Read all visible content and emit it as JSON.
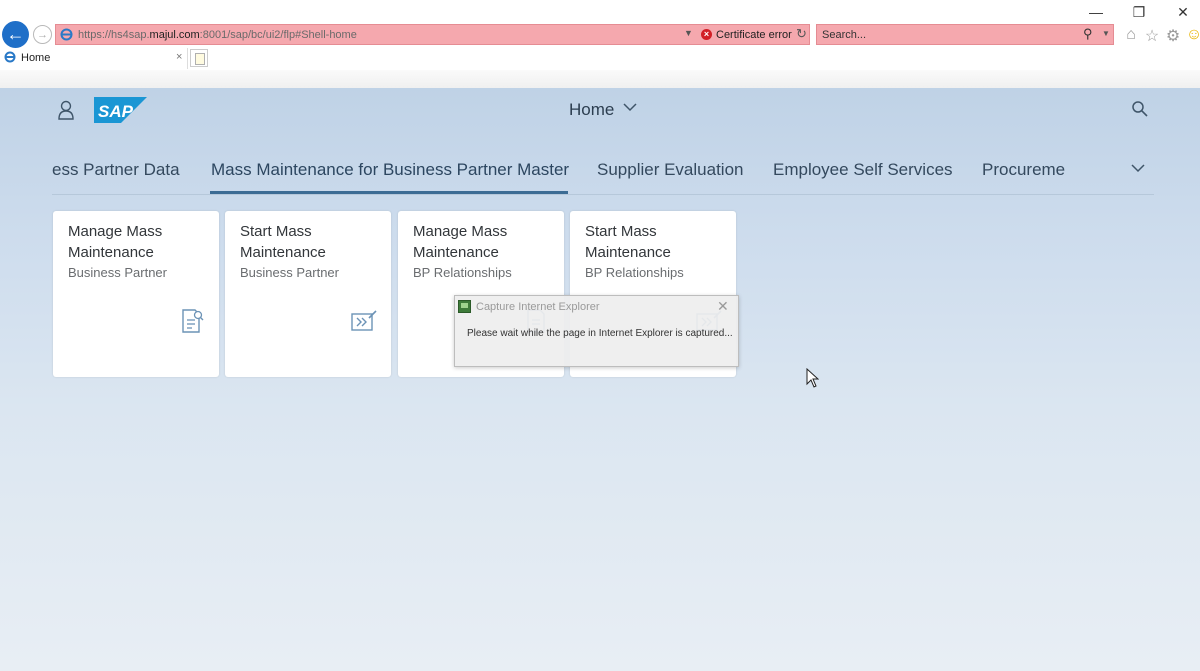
{
  "browser": {
    "window_controls": {
      "minimize": "—",
      "restore": "❐",
      "close": "✕"
    },
    "address": {
      "url_prefix": "https://hs4sap.",
      "url_domain": "majul.com",
      "url_suffix": ":8001/sap/bc/ui2/flp#Shell-home",
      "certificate_error": "Certificate error"
    },
    "search": {
      "placeholder": "Search..."
    },
    "tab": {
      "title": "Home",
      "close": "×"
    },
    "toolbar_icons": [
      "home-icon",
      "favorites-star-icon",
      "settings-gear-icon",
      "smiley-feedback-icon"
    ],
    "colors": {
      "address_bg": "#f5a8ae",
      "back_button": "#1f6fc8",
      "cert_error_icon": "#d21f26"
    }
  },
  "shell": {
    "logo_text": "SAP",
    "title": "Home",
    "colors": {
      "logo_blue": "#1a96d4",
      "background_top": "#bfd2e6",
      "background_bottom": "#e8eef4"
    }
  },
  "anchor_bar": {
    "items": [
      "ess Partner Data",
      "Mass Maintenance for Business Partner Master",
      "Supplier Evaluation",
      "Employee Self Services",
      "Procureme"
    ],
    "selected_index": 1
  },
  "tiles": [
    {
      "title": "Manage Mass Maintenance",
      "subtitle": "Business Partner",
      "icon": "document-search-icon"
    },
    {
      "title": "Start Mass Maintenance",
      "subtitle": "Business Partner",
      "icon": "forward-edit-icon"
    },
    {
      "title": "Manage Mass Maintenance",
      "subtitle": "BP Relationships",
      "icon": "document-search-icon"
    },
    {
      "title": "Start Mass Maintenance",
      "subtitle": "BP Relationships",
      "icon": "forward-edit-icon"
    }
  ],
  "dialog": {
    "title": "Capture Internet Explorer",
    "message": "Please wait while the page in Internet Explorer is captured...",
    "close": "✕"
  }
}
